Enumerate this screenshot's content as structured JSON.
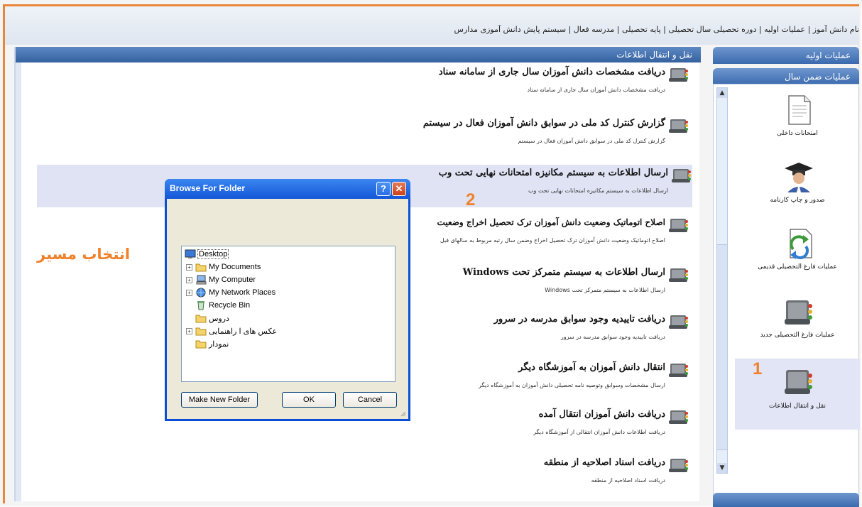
{
  "menubar": {
    "text": "نام دانش آموز  |  عملیات اولیه  |  دوره تحصیلی سال تحصیلی  |  پایه تحصیلی  |  مدرسه فعال  |  سیستم پایش دانش آموزی مدارس"
  },
  "center": {
    "header": "نقل و انتقال اطلاعات",
    "items": [
      {
        "title": "دریافت مشخصات دانش آموزان سال جاری از سامانه سناد",
        "sub": "دریافت مشخصات دانش آموزان سال جاری از سامانه سناد"
      },
      {
        "title": "گزارش کنترل کد ملی در سوابق دانش آموزان فعال در سیستم",
        "sub": "گزارش کنترل کد ملی در سوابق دانش آموزان فعال در سیستم"
      },
      {
        "title": "ارسال اطلاعات به سیستم مکانیزه امتحانات نهایی تحت وب",
        "sub": "ارسال اطلاعات به سیستم مکانیزه امتحانات نهایی تحت وب"
      },
      {
        "title": "اصلاح اتوماتیک وضعیت دانش آموزان ترک تحصیل اخراج وضعیت",
        "sub": "اصلاح اتوماتیک وضعیت دانش آموزان ترک تحصیل اخراج وضمن سال رتبه مربوط به سالهای قبل"
      },
      {
        "title": "ارسال اطلاعات به سیستم متمرکز تحت Windows",
        "sub": "ارسال اطلاعات به سیستم متمرکز تحت Windows"
      },
      {
        "title": "دریافت تاییدیه وجود سوابق مدرسه در سرور",
        "sub": "دریافت تاییدیه وجود سوابق مدرسه در سرور"
      },
      {
        "title": "انتقال دانش آموزان به آموزشگاه دیگر",
        "sub": "ارسال مشخصات وسوابق وتوصیه نامه تحصیلی دانش آموزان به آموزشگاه دیگر"
      },
      {
        "title": "دریافت دانش آموزان انتقال آمده",
        "sub": "دریافت اطلاعات دانش آموزان انتقالی از آموزشگاه دیگر"
      },
      {
        "title": "دریافت اسناد اصلاحیه از منطقه",
        "sub": "دریافت اسناد اصلاحیه از منطقه"
      }
    ]
  },
  "side": {
    "head1": "عملیات اولیه",
    "head2": "عملیات ضمن سال",
    "items": [
      {
        "label": "امتحانات داخلی",
        "icon": "document-icon"
      },
      {
        "label": "صدور و چاپ کارنامه",
        "icon": "graduate-icon"
      },
      {
        "label": "عملیات فارغ التحصیلی قدیمی",
        "icon": "refresh-document-icon"
      },
      {
        "label": "عملیات فارغ التحصیلی جدید",
        "icon": "book-icon"
      },
      {
        "label": "نقل و انتقال اطلاعات",
        "icon": "book-icon"
      }
    ]
  },
  "annotations": {
    "step1": "1",
    "step2": "2",
    "path_label": "انتخاب مسیر",
    "color": "#f0812a"
  },
  "dialog": {
    "title": "Browse For Folder",
    "help_label": "?",
    "close_label": "✕",
    "tree": [
      {
        "label": "Desktop",
        "icon": "desktop-icon",
        "expand": ""
      },
      {
        "label": "My Documents",
        "icon": "folder-icon",
        "expand": "+"
      },
      {
        "label": "My Computer",
        "icon": "computer-icon",
        "expand": "+"
      },
      {
        "label": "My Network Places",
        "icon": "network-icon",
        "expand": "+"
      },
      {
        "label": "Recycle Bin",
        "icon": "recycle-bin-icon",
        "expand": ""
      },
      {
        "label": "دروس",
        "icon": "folder-icon",
        "expand": ""
      },
      {
        "label": "عکس های ا راهنمایی",
        "icon": "folder-icon",
        "expand": "+"
      },
      {
        "label": "نمودار",
        "icon": "folder-icon",
        "expand": ""
      }
    ],
    "make_new_folder": "Make New Folder",
    "ok": "OK",
    "cancel": "Cancel"
  }
}
